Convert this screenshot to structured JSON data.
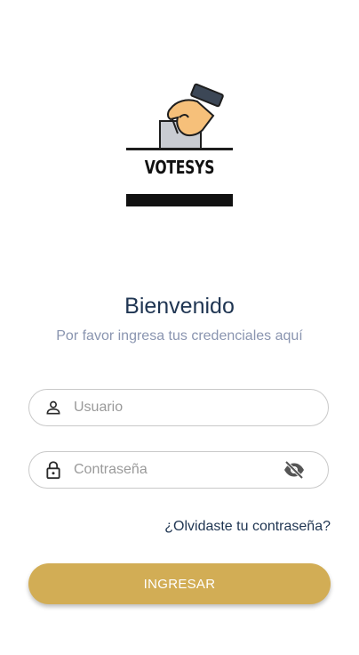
{
  "logo": {
    "text": "VOTESYS",
    "icon": "ballot-box-hand-icon"
  },
  "welcome": {
    "title": "Bienvenido",
    "subtitle": "Por favor ingresa tus credenciales aquí"
  },
  "form": {
    "username": {
      "placeholder": "Usuario",
      "value": "",
      "icon": "person-icon"
    },
    "password": {
      "placeholder": "Contraseña",
      "value": "",
      "icon": "lock-icon",
      "toggle_icon": "eye-off-icon"
    },
    "forgot_link": "¿Olvidaste tu contraseña?",
    "submit_label": "INGRESAR"
  },
  "colors": {
    "primary": "#d2ad55",
    "title_text": "#1f3552",
    "subtitle_text": "#8a95b0",
    "field_border": "#c9c9c9"
  }
}
